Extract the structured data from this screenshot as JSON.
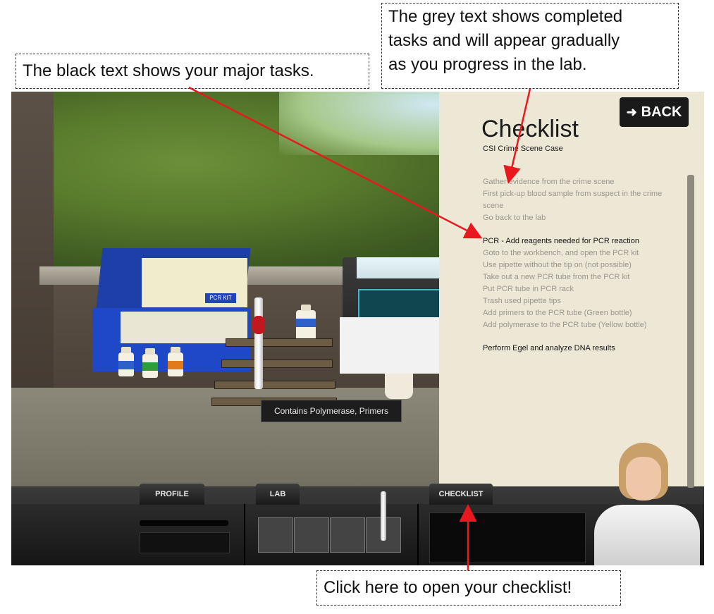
{
  "callouts": {
    "major": "The black text shows your major tasks.",
    "grey_line1": "The grey text shows completed",
    "grey_line2": "tasks and will appear gradually",
    "grey_line3": "as you progress in the lab.",
    "click": "Click here to open your checklist!"
  },
  "scene": {
    "kit_label": "PCR KIT",
    "tooltip": "Contains Polymerase, Primers"
  },
  "checklist": {
    "back_label": "BACK",
    "title": "Checklist",
    "subtitle": "CSI Crime Scene Case",
    "items": [
      {
        "text": "Gather evidence from the crime scene",
        "major": false
      },
      {
        "text": "First pick-up blood sample from suspect in the crime scene",
        "major": false
      },
      {
        "text": "Go back to the lab",
        "major": false
      },
      {
        "text": "PCR - Add reagents needed for PCR reaction",
        "major": true
      },
      {
        "text": "Goto to the workbench, and open the PCR kit",
        "major": false
      },
      {
        "text": "Use pipette without the tip on (not possible)",
        "major": false
      },
      {
        "text": "Take out a new PCR tube from the PCR kit",
        "major": false
      },
      {
        "text": "Put PCR tube in PCR rack",
        "major": false
      },
      {
        "text": "Trash used pipette tips",
        "major": false
      },
      {
        "text": "Add primers to the PCR tube (Green bottle)",
        "major": false
      },
      {
        "text": "Add polymerase to the PCR tube (Yellow bottle)",
        "major": false
      },
      {
        "text": "Perform Egel and analyze DNA results",
        "major": true
      }
    ]
  },
  "tabs": {
    "profile": "PROFILE",
    "lab": "LAB",
    "checklist": "CHECKLIST"
  },
  "colors": {
    "arrow": "#e8181e",
    "major_text": "#151515",
    "completed_text": "#9b968c",
    "checklist_bg": "#ede7d6"
  }
}
